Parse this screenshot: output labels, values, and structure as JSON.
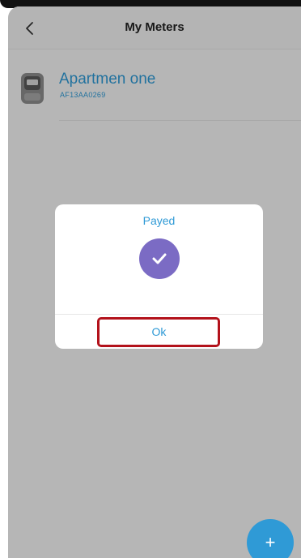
{
  "header": {
    "title": "My Meters"
  },
  "meters": [
    {
      "name": "Apartmen one",
      "id": "AF13AA0269"
    }
  ],
  "dialog": {
    "title": "Payed",
    "ok_label": "Ok"
  },
  "fab": {
    "icon": "plus-icon",
    "label": "+"
  },
  "colors": {
    "accent": "#2f9ad6",
    "check_badge": "#7b6bc4",
    "highlight": "#b3121b"
  }
}
